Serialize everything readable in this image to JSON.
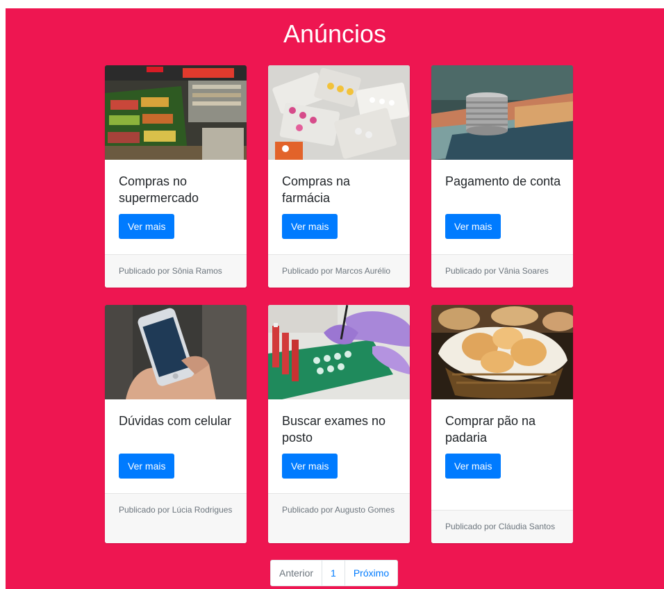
{
  "header": {
    "title": "Anúncios"
  },
  "cards": [
    {
      "title": "Compras no supermercado",
      "button": "Ver mais",
      "footer": "Publicado por Sônia Ramos",
      "image_icon": "supermarket-image"
    },
    {
      "title": "Compras na farmácia",
      "button": "Ver mais",
      "footer": "Publicado por Marcos Aurélio",
      "image_icon": "pills-image"
    },
    {
      "title": "Pagamento de conta",
      "button": "Ver mais",
      "footer": "Publicado por Vânia Soares",
      "image_icon": "money-image"
    },
    {
      "title": "Dúvidas com celular",
      "button": "Ver mais",
      "footer": "Publicado por Lúcia Rodrigues",
      "image_icon": "phone-image"
    },
    {
      "title": "Buscar exames no posto",
      "button": "Ver mais",
      "footer": "Publicado por Augusto Gomes",
      "image_icon": "lab-image"
    },
    {
      "title": "Comprar pão na padaria",
      "button": "Ver mais",
      "footer": "Publicado por Cláudia Santos",
      "image_icon": "bread-image"
    }
  ],
  "pagination": {
    "prev": "Anterior",
    "page": "1",
    "next": "Próximo"
  },
  "colors": {
    "background": "#ee1651",
    "button": "#007bff",
    "card": "#ffffff"
  }
}
